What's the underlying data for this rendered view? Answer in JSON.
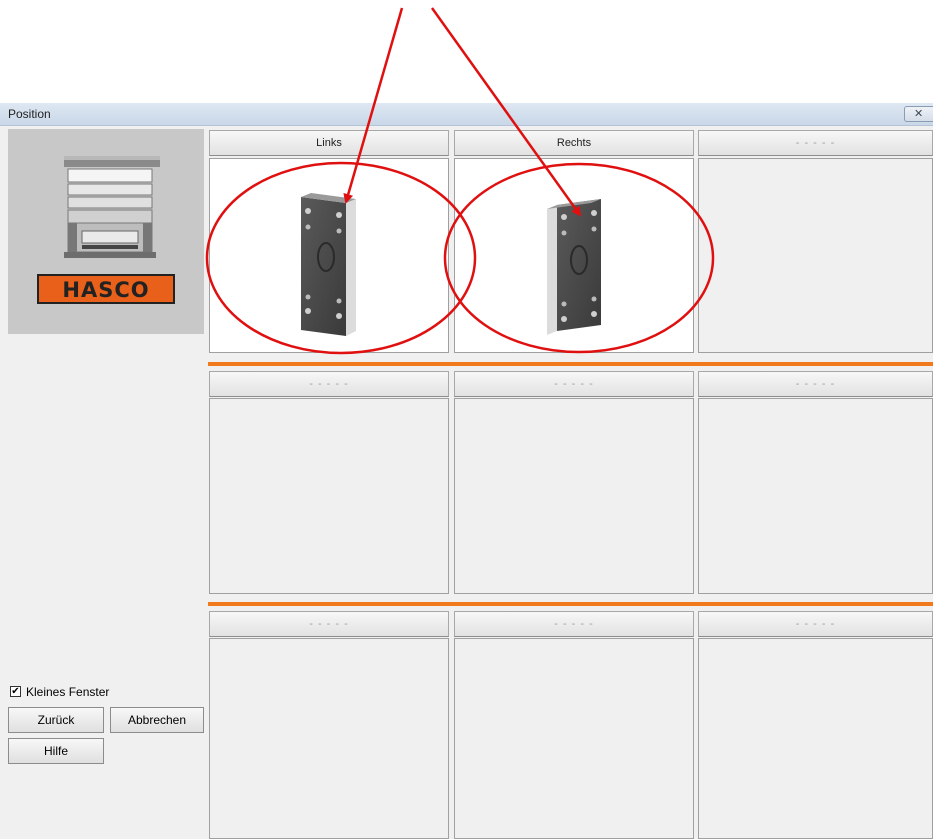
{
  "window": {
    "title": "Position"
  },
  "brand": {
    "logo_text": "HASCO"
  },
  "grid": {
    "rows": [
      {
        "cells": [
          {
            "label": "Links"
          },
          {
            "label": "Rechts"
          },
          {
            "label": "- - - - -"
          }
        ]
      },
      {
        "cells": [
          {
            "label": "- - - - -"
          },
          {
            "label": "- - - - -"
          },
          {
            "label": "- - - - -"
          }
        ]
      },
      {
        "cells": [
          {
            "label": "- - - - -"
          },
          {
            "label": "- - - - -"
          },
          {
            "label": "- - - - -"
          }
        ]
      }
    ]
  },
  "options": {
    "small_window_label": "Kleines Fenster",
    "small_window_checked": true
  },
  "buttons": {
    "back": "Zurück",
    "cancel": "Abbrechen",
    "help": "Hilfe"
  },
  "colors": {
    "separator": "#f07a1c",
    "annotation": "#e01010"
  }
}
